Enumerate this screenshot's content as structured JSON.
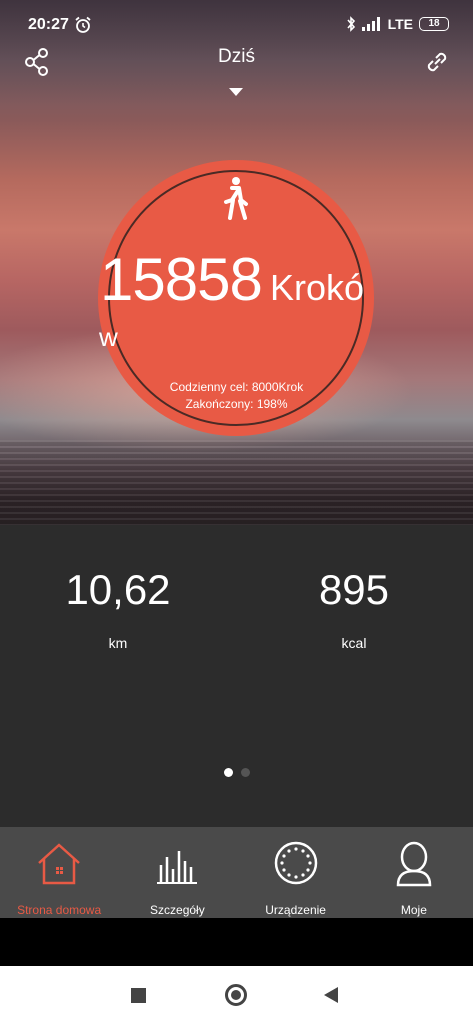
{
  "status_bar": {
    "time": "20:27",
    "network": "LTE",
    "battery": "18"
  },
  "header": {
    "title": "Dziś"
  },
  "steps": {
    "value": "15858",
    "unit_part1": "Krokó",
    "unit_part2": "w",
    "goal_text": "Codzienny cel: 8000Krok",
    "completed_text": "Zakończony: 198%"
  },
  "stats": {
    "distance_value": "10,62",
    "distance_unit": "km",
    "calories_value": "895",
    "calories_unit": "kcal"
  },
  "pager": {
    "pages": 2,
    "active": 0
  },
  "bottom_nav": {
    "items": [
      {
        "label": "Strona domowa",
        "icon": "home-icon",
        "active": true
      },
      {
        "label": "Szczegóły",
        "icon": "bar-chart-icon",
        "active": false
      },
      {
        "label": "Urządzenie",
        "icon": "watch-icon",
        "active": false
      },
      {
        "label": "Moje",
        "icon": "profile-icon",
        "active": false
      }
    ]
  },
  "colors": {
    "accent": "#e85a45",
    "stats_bg": "#2c2c2c",
    "nav_bg": "#4a4a4a"
  }
}
